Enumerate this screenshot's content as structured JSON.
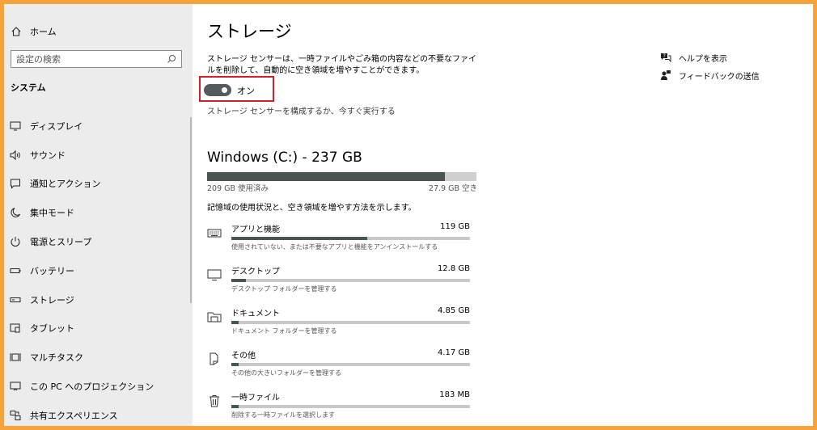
{
  "sidebar": {
    "home_label": "ホーム",
    "search_placeholder": "設定の検索",
    "section_title": "システム",
    "items": [
      {
        "label": "ディスプレイ",
        "icon": "display-icon"
      },
      {
        "label": "サウンド",
        "icon": "speaker-icon"
      },
      {
        "label": "通知とアクション",
        "icon": "notification-icon"
      },
      {
        "label": "集中モード",
        "icon": "moon-icon"
      },
      {
        "label": "電源とスリープ",
        "icon": "power-icon"
      },
      {
        "label": "バッテリー",
        "icon": "battery-icon"
      },
      {
        "label": "ストレージ",
        "icon": "storage-icon"
      },
      {
        "label": "タブレット",
        "icon": "tablet-icon"
      },
      {
        "label": "マルチタスク",
        "icon": "multitask-icon"
      },
      {
        "label": "この PC へのプロジェクション",
        "icon": "projection-icon"
      },
      {
        "label": "共有エクスペリエンス",
        "icon": "shared-icon"
      }
    ]
  },
  "main": {
    "title": "ストレージ",
    "description": "ストレージ センサーは、一時ファイルやごみ箱の内容などの不要なファイルを削除して、自動的に空き領域を増やすことができます。",
    "toggle_label": "オン",
    "toggle_on": true,
    "config_link": "ストレージ センサーを構成するか、今すぐ実行する",
    "drive": {
      "title": "Windows (C:) - 237 GB",
      "used_label": "209 GB 使用済み",
      "free_label": "27.9 GB 空き",
      "used_fraction": 0.882
    },
    "hint": "記憶域の使用状況と、空き領域を増やす方法を示します。",
    "categories": [
      {
        "name": "アプリと機能",
        "size": "119 GB",
        "sub": "使用されていない、または不要なアプリと機能をアンインストールする",
        "fraction": 0.57,
        "icon": "keyboard-icon"
      },
      {
        "name": "デスクトップ",
        "size": "12.8 GB",
        "sub": "デスクトップ フォルダーを管理する",
        "fraction": 0.061,
        "icon": "monitor-icon"
      },
      {
        "name": "ドキュメント",
        "size": "4.85 GB",
        "sub": "ドキュメント フォルダーを管理する",
        "fraction": 0.023,
        "icon": "folder-icon"
      },
      {
        "name": "その他",
        "size": "4.17 GB",
        "sub": "その他の大きいフォルダーを管理する",
        "fraction": 0.02,
        "icon": "document-icon"
      },
      {
        "name": "一時ファイル",
        "size": "183 MB",
        "sub": "削除する一時ファイルを選択します",
        "fraction": 0.002,
        "icon": "trash-icon"
      }
    ]
  },
  "right": {
    "help_label": "ヘルプを表示",
    "feedback_label": "フィードバックの送信"
  }
}
